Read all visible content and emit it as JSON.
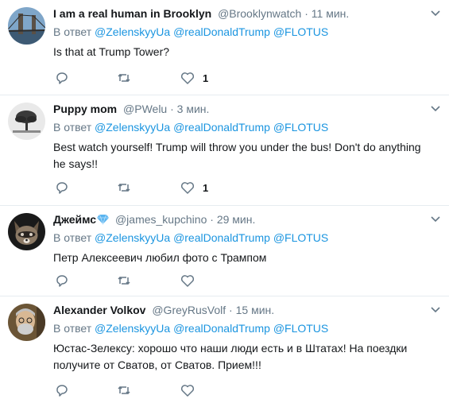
{
  "reply_prefix": "В ответ",
  "mentions": [
    "@ZelenskyyUa",
    "@realDonaldTrump",
    "@FLOTUS"
  ],
  "accent_color": "#1b95e0",
  "tweets": [
    {
      "name": "I am a real human in Brooklyn",
      "handle": "@Brooklynwatch",
      "time": "11 мин.",
      "text": "Is that at Trump Tower?",
      "likes": "1",
      "avatar": "brooklyn-bridge-avatar"
    },
    {
      "name": "Puppy mom",
      "handle": "@PWelu",
      "time": "3 мин.",
      "text": "Best watch yourself! Trump will throw you under the bus! Don't do anything he says!!",
      "likes": "1",
      "avatar": "tree-avatar"
    },
    {
      "name": "Джеймс",
      "handle": "@james_kupchino",
      "time": "29 мин.",
      "text": "Петр Алексеевич любил фото с Трампом",
      "likes": "",
      "avatar": "raccoon-avatar"
    },
    {
      "name": "Alexander Volkov",
      "handle": "@GreyRusVolf",
      "time": "15 мин.",
      "text": "Юстас-Зелексу: хорошо что наши люди есть и в Штатах! На поездки получите от Сватов, от Сватов. Прием!!!",
      "likes": "",
      "avatar": "man-avatar"
    }
  ]
}
